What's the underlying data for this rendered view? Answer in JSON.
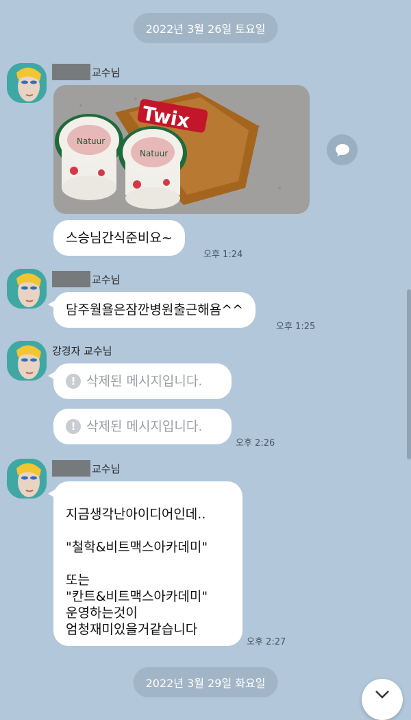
{
  "dates": {
    "first": "2022년 3월 26일 토요일",
    "second": "2022년 3월 29일 화요일"
  },
  "messages": [
    {
      "sender": "교수님",
      "photo_label": "Twix",
      "cup_brand": "Natuur",
      "text": "스승님간식준비요~",
      "time": "오후 1:24"
    },
    {
      "sender": "교수님",
      "text": "담주월욜은잠깐병원출근해욤^^",
      "time": "오후 1:25"
    },
    {
      "sender": "강경자 교수님",
      "deleted1": "삭제된 메시지입니다.",
      "deleted2": "삭제된 메시지입니다.",
      "time": "오후 2:26"
    },
    {
      "sender": "교수님",
      "text": "지금생각난아이디어인데..\n\n\"철학&비트맥스아카데미\"\n\n또는\n\"칸트&비트맥스아카데미\"\n운영하는것이\n엄청재미있을거같습니다",
      "time": "오후 2:27"
    }
  ],
  "icons": {
    "warning": "!",
    "share": "speech-bubble-icon",
    "scroll_down": "chevron-down-icon"
  },
  "colors": {
    "background": "#b2c7da",
    "bubble": "#ffffff",
    "date_pill": "#a2b5c6"
  }
}
